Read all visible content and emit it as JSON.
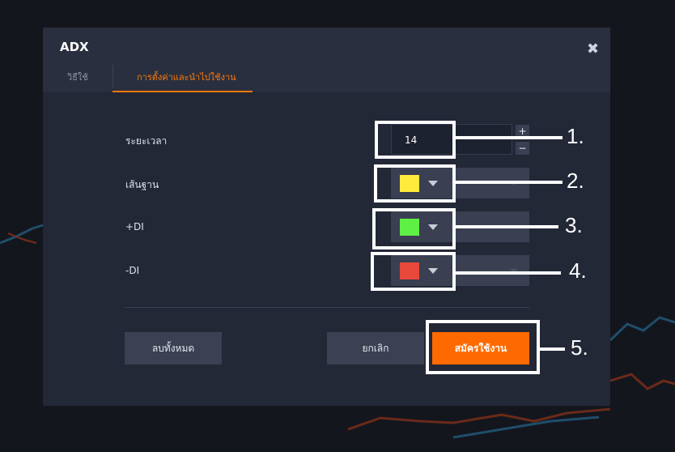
{
  "dialog": {
    "title": "ADX",
    "close_icon": "close-icon"
  },
  "tabs": [
    {
      "label": "วิธีใช้",
      "active": false
    },
    {
      "label": "การตั้งค่าและนำไปใช้งาน",
      "active": true
    }
  ],
  "fields": {
    "period": {
      "label": "ระยะเวลา",
      "value": "14",
      "increment": "+",
      "decrement": "−"
    },
    "baseline": {
      "label": "เส้นฐาน",
      "color": "#ffeb3b"
    },
    "plus_di": {
      "label": "+DI",
      "color": "#5fef45"
    },
    "minus_di": {
      "label": "-DI",
      "color": "#e8493a"
    }
  },
  "buttons": {
    "reset": "ลบทั้งหมด",
    "cancel": "ยกเลิก",
    "apply": "สมัครใช้งาน"
  },
  "callouts": [
    "1.",
    "2.",
    "3.",
    "4.",
    "5."
  ],
  "colors": {
    "accent": "#f97a0a",
    "apply_button": "#ff6a00",
    "dialog_bg": "#232837"
  }
}
